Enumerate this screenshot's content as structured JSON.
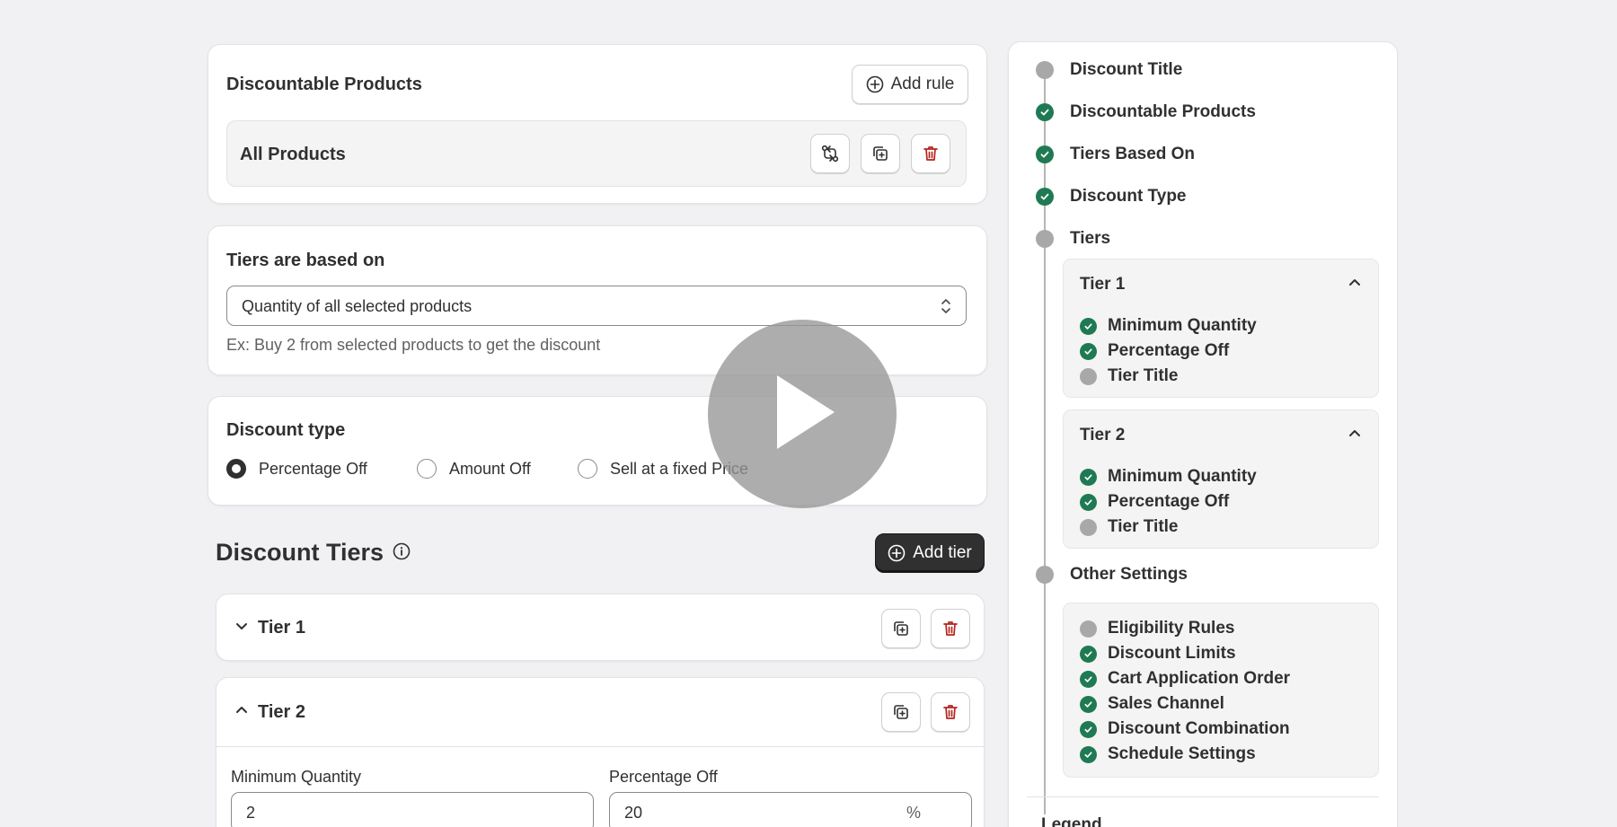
{
  "products": {
    "title": "Discountable Products",
    "add_rule_label": "Add rule",
    "rule_label": "All Products"
  },
  "basis": {
    "title": "Tiers are based on",
    "selected": "Quantity of all selected products",
    "help": "Ex: Buy 2 from selected products to get the discount"
  },
  "type": {
    "title": "Discount type",
    "options": [
      "Percentage Off",
      "Amount Off",
      "Sell at a fixed Price"
    ],
    "selected_index": 0
  },
  "tiers": {
    "title": "Discount Tiers",
    "add_tier_label": "Add tier",
    "items": [
      {
        "label": "Tier 1",
        "expanded": false
      },
      {
        "label": "Tier 2",
        "expanded": true
      }
    ],
    "tier2_fields": {
      "min_qty_label": "Minimum Quantity",
      "min_qty_value": "2",
      "pct_label": "Percentage Off",
      "pct_value": "20",
      "pct_suffix": "%"
    }
  },
  "nav": {
    "steps": [
      {
        "label": "Discount Title",
        "done": false
      },
      {
        "label": "Discountable Products",
        "done": true
      },
      {
        "label": "Tiers Based On",
        "done": true
      },
      {
        "label": "Discount Type",
        "done": true
      },
      {
        "label": "Tiers",
        "done": false
      },
      {
        "label": "Other Settings",
        "done": false
      }
    ],
    "tier_panels": [
      {
        "title": "Tier 1",
        "items": [
          {
            "label": "Minimum Quantity",
            "done": true
          },
          {
            "label": "Percentage Off",
            "done": true
          },
          {
            "label": "Tier Title",
            "done": false
          }
        ]
      },
      {
        "title": "Tier 2",
        "items": [
          {
            "label": "Minimum Quantity",
            "done": true
          },
          {
            "label": "Percentage Off",
            "done": true
          },
          {
            "label": "Tier Title",
            "done": false
          }
        ]
      }
    ],
    "other_settings": [
      {
        "label": "Eligibility Rules",
        "done": false
      },
      {
        "label": "Discount Limits",
        "done": true
      },
      {
        "label": "Cart Application Order",
        "done": true
      },
      {
        "label": "Sales Channel",
        "done": true
      },
      {
        "label": "Discount Combination",
        "done": true
      },
      {
        "label": "Schedule Settings",
        "done": true
      }
    ],
    "legend_title": "Legend"
  },
  "colors": {
    "done": "#1f7a54",
    "pending": "#a8a8a8",
    "danger": "#b3261e",
    "primary": "#303030"
  },
  "icons": {
    "add_rule": "plus-circle-icon",
    "swap": "swap-arrows-icon",
    "duplicate": "duplicate-icon",
    "delete": "trash-icon",
    "select": "select-chevrons-icon",
    "info": "info-icon",
    "chevron_down": "chevron-down-icon",
    "chevron_up": "chevron-up-icon",
    "check": "check-icon",
    "play": "play-icon"
  }
}
